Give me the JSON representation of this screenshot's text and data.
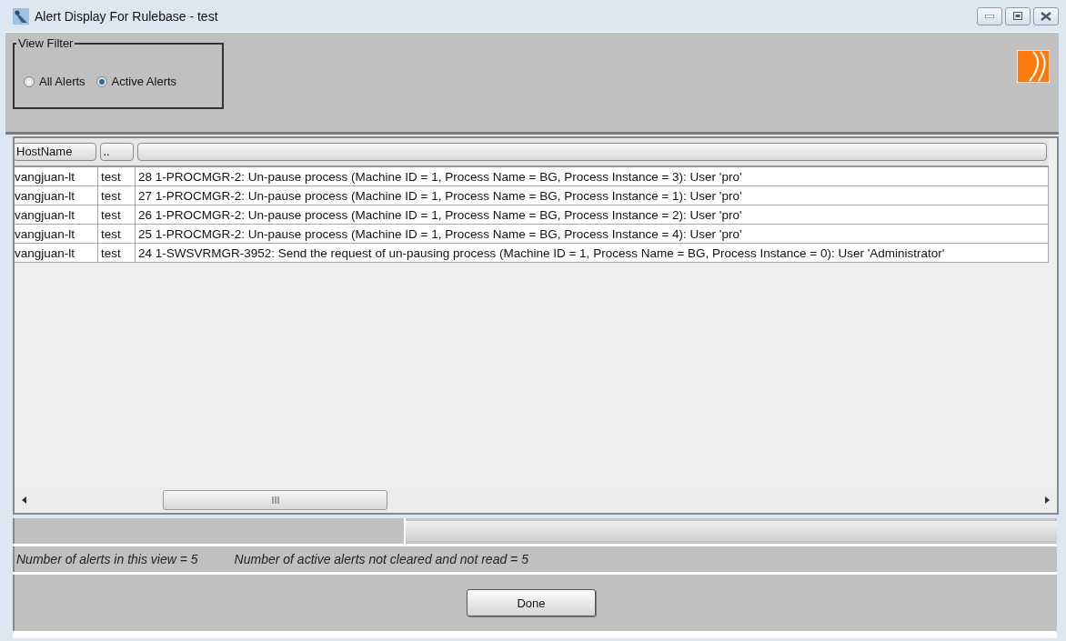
{
  "window": {
    "title": "Alert Display For Rulebase - test"
  },
  "view_filter": {
    "legend": "View Filter",
    "options": [
      {
        "label": "All Alerts",
        "selected": false
      },
      {
        "label": "Active Alerts",
        "selected": true
      }
    ]
  },
  "table": {
    "columns": [
      "HostName",
      "..",
      ""
    ],
    "rows": [
      {
        "cells": [
          "vangjuan-lt",
          "test",
          "28 1-PROCMGR-2: Un-pause process (Machine ID = 1, Process Name = BG, Process Instance = 3): User 'pro'"
        ]
      },
      {
        "cells": [
          "vangjuan-lt",
          "test",
          "27 1-PROCMGR-2: Un-pause process (Machine ID = 1, Process Name = BG, Process Instance = 1): User 'pro'"
        ]
      },
      {
        "cells": [
          "vangjuan-lt",
          "test",
          "26 1-PROCMGR-2: Un-pause process (Machine ID = 1, Process Name = BG, Process Instance = 2): User 'pro'"
        ]
      },
      {
        "cells": [
          "vangjuan-lt",
          "test",
          "25 1-PROCMGR-2: Un-pause process (Machine ID = 1, Process Name = BG, Process Instance = 4): User 'pro'"
        ]
      },
      {
        "cells": [
          "vangjuan-lt",
          "test",
          "24 1-SWSVRMGR-3952: Send the request of un-pausing process (Machine ID = 1, Process Name = BG, Process Instance = 0): User 'Administrator'"
        ]
      }
    ]
  },
  "status": {
    "alerts_in_view": "Number of alerts in this view  =  5",
    "active_not_cleared": "Number of active alerts not cleared and not read  =  5"
  },
  "buttons": [
    "Done"
  ]
}
